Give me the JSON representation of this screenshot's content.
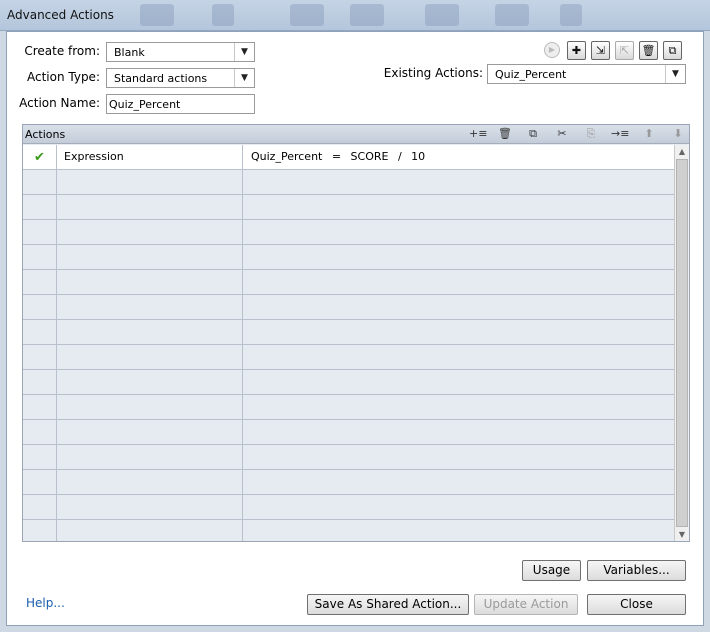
{
  "window": {
    "title": "Advanced Actions"
  },
  "form": {
    "create_from_label": "Create from:",
    "create_from_value": "Blank",
    "action_type_label": "Action Type:",
    "action_type_value": "Standard actions",
    "action_name_label": "Action Name:",
    "action_name_value": "Quiz_Percent",
    "existing_actions_label": "Existing Actions:",
    "existing_actions_value": "Quiz_Percent"
  },
  "top_toolbar": {
    "icons": [
      "preview-icon",
      "add-icon",
      "import-icon",
      "export-icon",
      "delete-icon",
      "duplicate-icon"
    ],
    "glyphs": {
      "add": "✚",
      "import": "⇲",
      "export": "⇱",
      "delete": "🗑",
      "duplicate": "⧉",
      "preview": "▶"
    }
  },
  "actions_grid": {
    "header": "Actions",
    "toolbar_glyphs": {
      "insert": "+≡",
      "delete": "🗑",
      "copy": "⧉",
      "cut": "✂",
      "paste": "⎘",
      "indent": "→≡",
      "up": "⬆",
      "down": "⬇"
    },
    "rows": [
      {
        "status": "✔",
        "action": "Expression",
        "detail": "Quiz_Percent = SCORE / 10"
      }
    ],
    "empty_rows": 15
  },
  "buttons": {
    "usage": "Usage",
    "variables": "Variables...",
    "save_shared": "Save As Shared Action...",
    "update_action": "Update Action",
    "close": "Close",
    "help": "Help..."
  },
  "colors": {
    "accent_link": "#1b5fae",
    "check": "#3a9a1a"
  }
}
